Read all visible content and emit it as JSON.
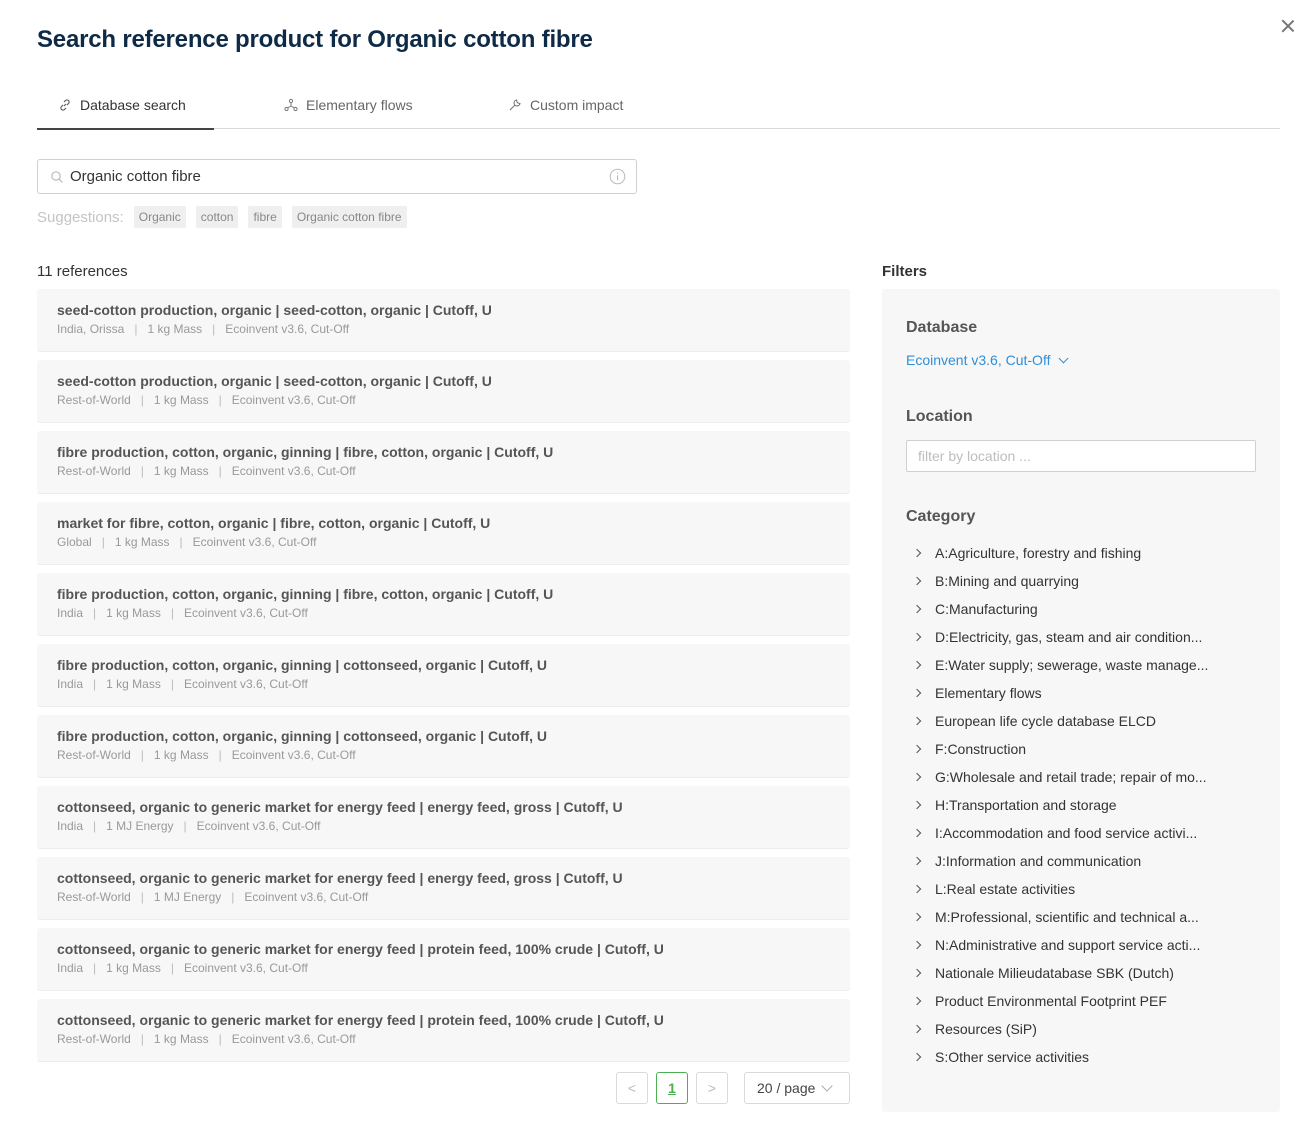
{
  "dialog": {
    "title": "Search reference product for Organic cotton fibre",
    "close_icon": "close-icon"
  },
  "tabs": [
    {
      "label": "Database search",
      "icon": "link-icon",
      "active": true
    },
    {
      "label": "Elementary flows",
      "icon": "network-icon",
      "active": false
    },
    {
      "label": "Custom impact",
      "icon": "wrench-icon",
      "active": false
    }
  ],
  "search": {
    "value": "Organic cotton fibre",
    "icon": "search-icon",
    "info_icon": "info-icon"
  },
  "suggestions": {
    "label": "Suggestions:",
    "items": [
      "Organic",
      "cotton",
      "fibre",
      "Organic cotton fibre"
    ]
  },
  "results": {
    "count_label": "11 references",
    "items": [
      {
        "title": "seed-cotton production, organic | seed-cotton, organic | Cutoff, U",
        "location": "India, Orissa",
        "unit": "1 kg Mass",
        "database": "Ecoinvent v3.6, Cut-Off"
      },
      {
        "title": "seed-cotton production, organic | seed-cotton, organic | Cutoff, U",
        "location": "Rest-of-World",
        "unit": "1 kg Mass",
        "database": "Ecoinvent v3.6, Cut-Off"
      },
      {
        "title": "fibre production, cotton, organic, ginning | fibre, cotton, organic | Cutoff, U",
        "location": "Rest-of-World",
        "unit": "1 kg Mass",
        "database": "Ecoinvent v3.6, Cut-Off"
      },
      {
        "title": "market for fibre, cotton, organic | fibre, cotton, organic | Cutoff, U",
        "location": "Global",
        "unit": "1 kg Mass",
        "database": "Ecoinvent v3.6, Cut-Off"
      },
      {
        "title": "fibre production, cotton, organic, ginning | fibre, cotton, organic | Cutoff, U",
        "location": "India",
        "unit": "1 kg Mass",
        "database": "Ecoinvent v3.6, Cut-Off"
      },
      {
        "title": "fibre production, cotton, organic, ginning | cottonseed, organic | Cutoff, U",
        "location": "India",
        "unit": "1 kg Mass",
        "database": "Ecoinvent v3.6, Cut-Off"
      },
      {
        "title": "fibre production, cotton, organic, ginning | cottonseed, organic | Cutoff, U",
        "location": "Rest-of-World",
        "unit": "1 kg Mass",
        "database": "Ecoinvent v3.6, Cut-Off"
      },
      {
        "title": "cottonseed, organic to generic market for energy feed | energy feed, gross | Cutoff, U",
        "location": "India",
        "unit": "1 MJ Energy",
        "database": "Ecoinvent v3.6, Cut-Off"
      },
      {
        "title": "cottonseed, organic to generic market for energy feed | energy feed, gross | Cutoff, U",
        "location": "Rest-of-World",
        "unit": "1 MJ Energy",
        "database": "Ecoinvent v3.6, Cut-Off"
      },
      {
        "title": "cottonseed, organic to generic market for energy feed | protein feed, 100% crude | Cutoff, U",
        "location": "India",
        "unit": "1 kg Mass",
        "database": "Ecoinvent v3.6, Cut-Off"
      },
      {
        "title": "cottonseed, organic to generic market for energy feed | protein feed, 100% crude | Cutoff, U",
        "location": "Rest-of-World",
        "unit": "1 kg Mass",
        "database": "Ecoinvent v3.6, Cut-Off"
      }
    ]
  },
  "pagination": {
    "prev": "<",
    "current_page": "1",
    "next": ">",
    "page_size": "20 / page"
  },
  "filters": {
    "title": "Filters",
    "database_heading": "Database",
    "database_value": "Ecoinvent v3.6, Cut-Off",
    "location_heading": "Location",
    "location_placeholder": "filter by location ...",
    "category_heading": "Category",
    "categories": [
      "A:Agriculture, forestry and fishing",
      "B:Mining and quarrying",
      "C:Manufacturing",
      "D:Electricity, gas, steam and air condition...",
      "E:Water supply; sewerage, waste manage...",
      "Elementary flows",
      "European life cycle database ELCD",
      "F:Construction",
      "G:Wholesale and retail trade; repair of mo...",
      "H:Transportation and storage",
      "I:Accommodation and food service activi...",
      "J:Information and communication",
      "L:Real estate activities",
      "M:Professional, scientific and technical a...",
      "N:Administrative and support service acti...",
      "Nationale Milieudatabase SBK (Dutch)",
      "Product Environmental Footprint PEF",
      "Resources (SiP)",
      "S:Other service activities"
    ]
  },
  "colors": {
    "title": "#0e2a47",
    "link_blue": "#2f8fd8",
    "current_page_green": "#4caf50"
  }
}
